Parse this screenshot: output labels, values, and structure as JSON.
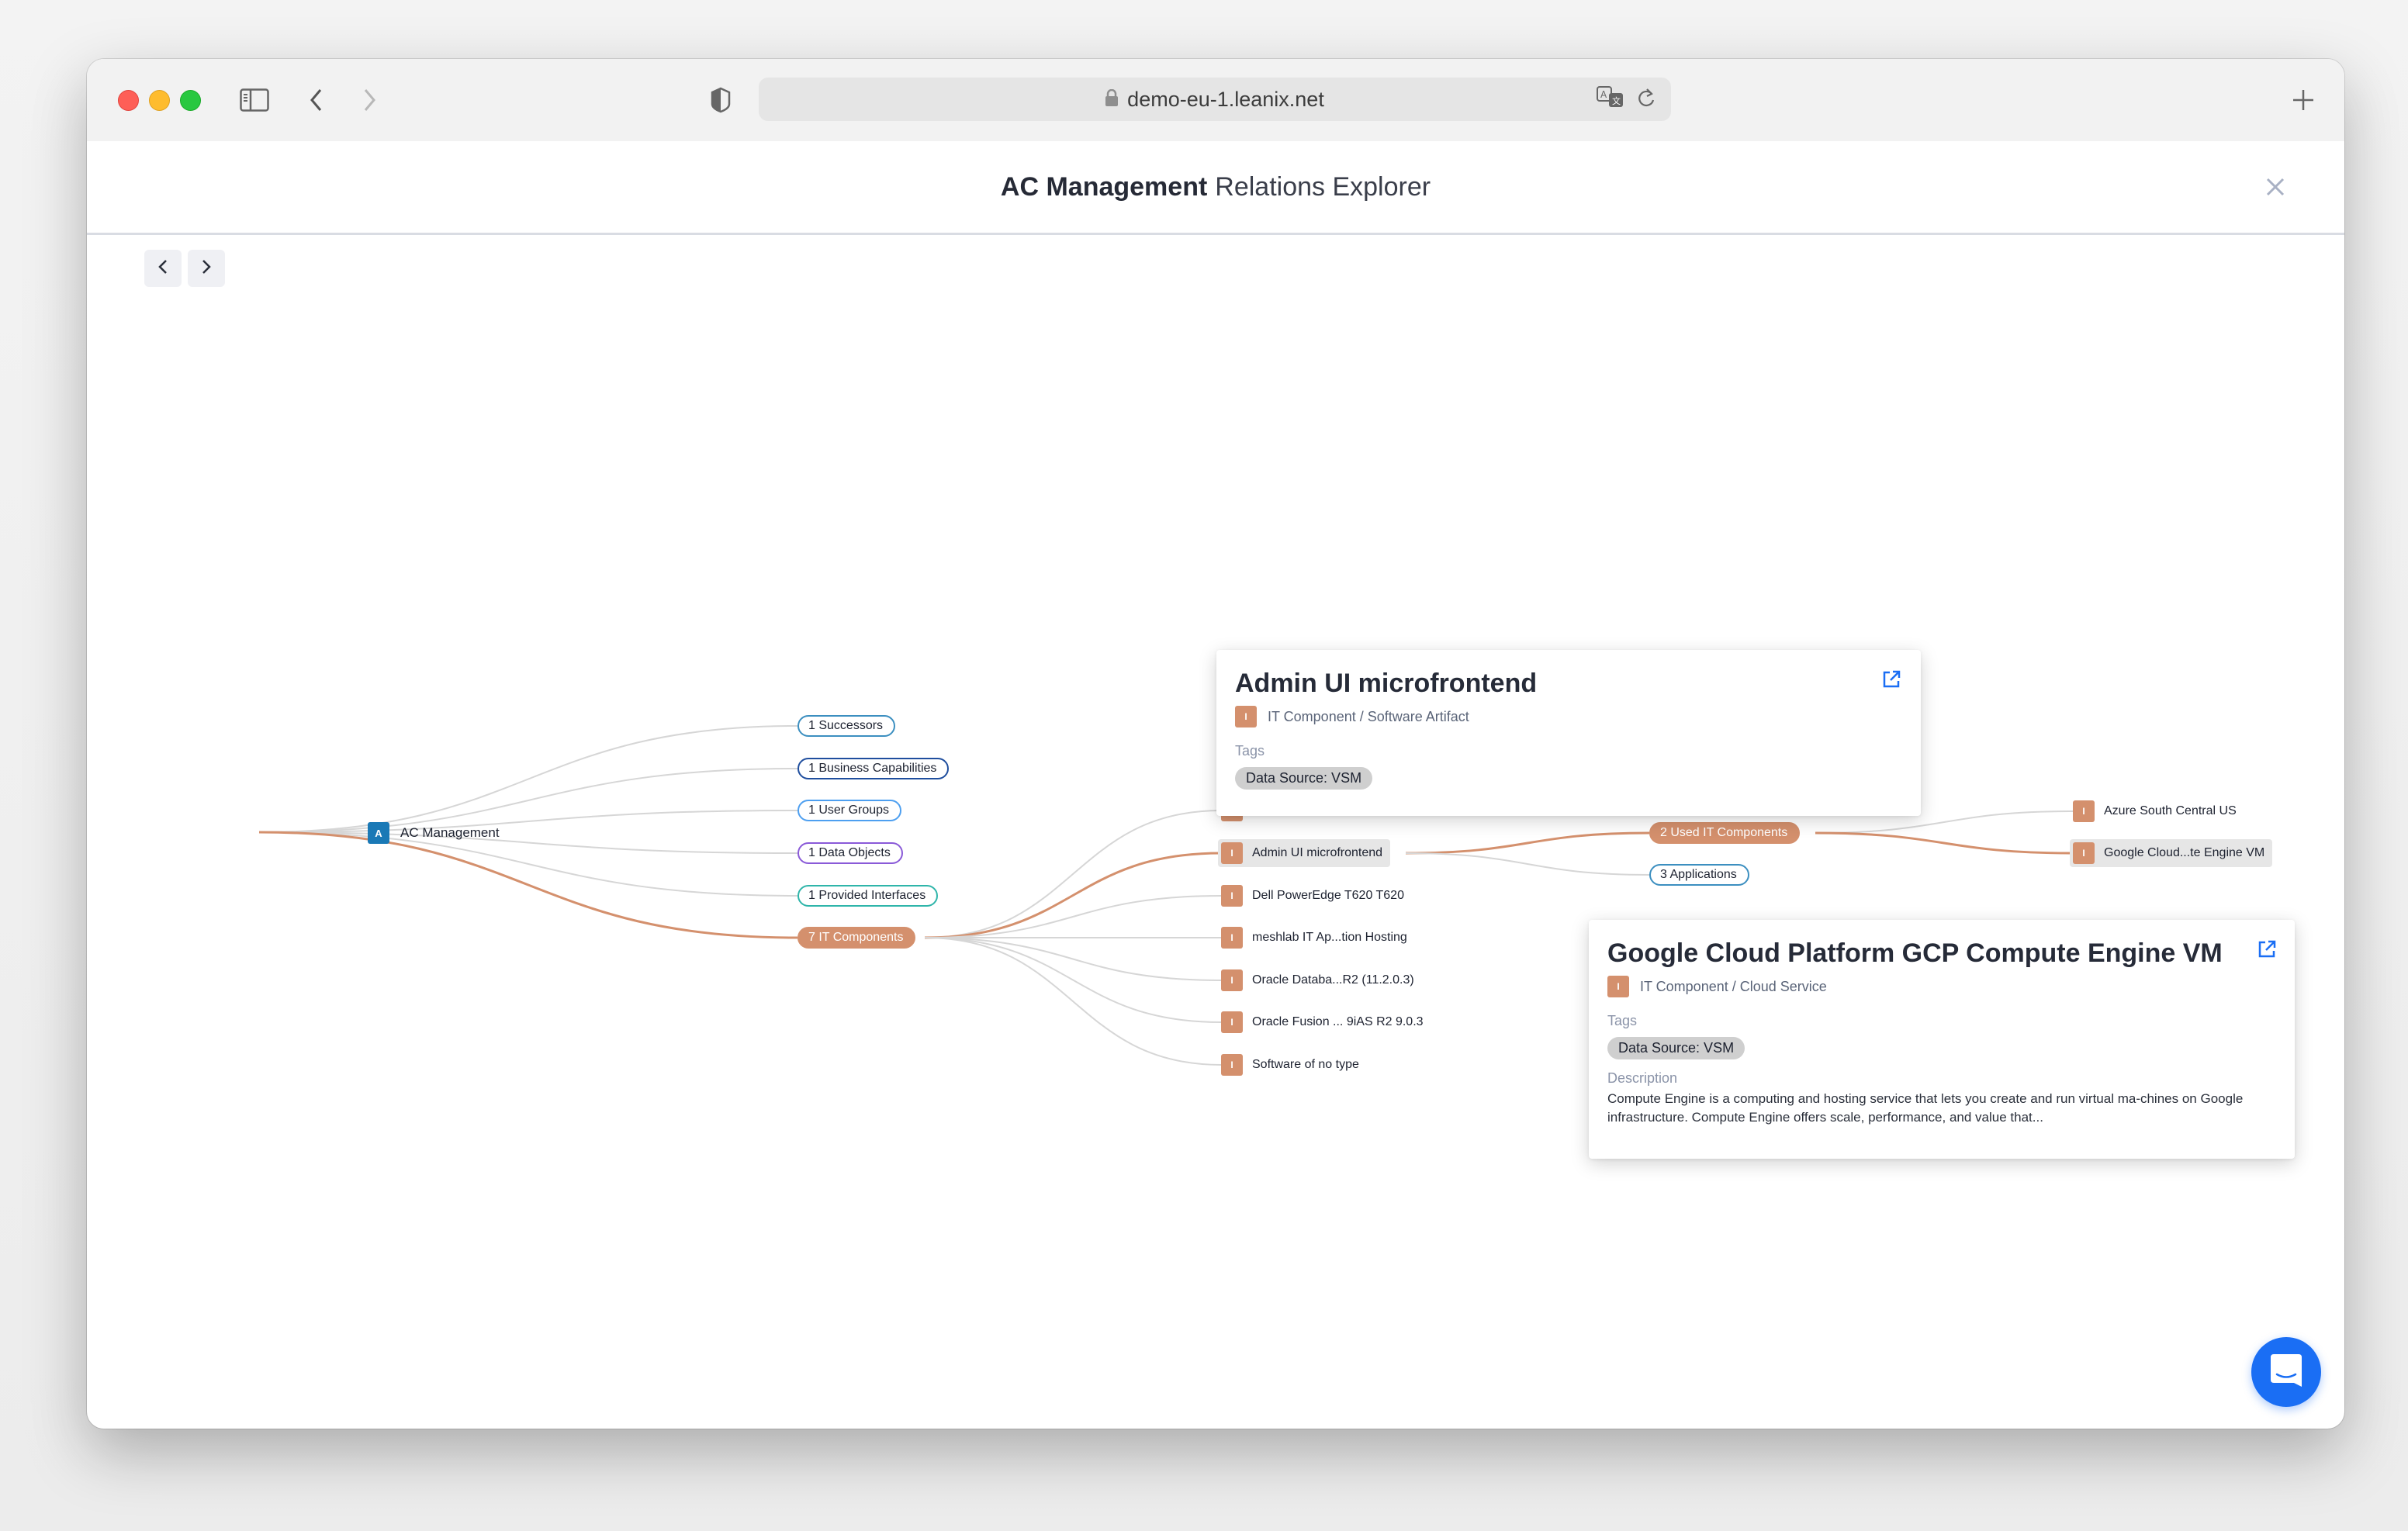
{
  "browser": {
    "url": "demo-eu-1.leanix.net",
    "icons": {
      "sidebar": "sidebar-toggle-icon",
      "back": "chevron-left-icon",
      "forward": "chevron-right-icon",
      "privacy": "shield-icon",
      "lock": "lock-icon",
      "translate": "translate-icon",
      "reload": "reload-icon",
      "new_tab": "plus-icon"
    }
  },
  "header": {
    "title_bold": "AC Management",
    "title_light": "Relations Explorer",
    "close_icon": "close-icon"
  },
  "history_nav": {
    "prev_icon": "chevron-left-icon",
    "next_icon": "chevron-right-icon"
  },
  "graph": {
    "root": {
      "badge": "A",
      "label": "AC Management",
      "color": "#1a79b6"
    },
    "relation_groups": [
      {
        "label": "1 Successors",
        "border": "#3c8fc0",
        "filled": false
      },
      {
        "label": "1 Business Capabilities",
        "border": "#1f4e9e",
        "filled": false
      },
      {
        "label": "1 User Groups",
        "border": "#4d9ff0",
        "filled": false
      },
      {
        "label": "1 Data Objects",
        "border": "#8a5ad8",
        "filled": false
      },
      {
        "label": "1 Provided Interfaces",
        "border": "#2fb5aa",
        "filled": false
      },
      {
        "label": "7 IT Components",
        "border": "#d4906d",
        "filled": true
      }
    ],
    "it_components": [
      {
        "badge": "I",
        "label": "",
        "hidden_by_popover": true,
        "selected": false
      },
      {
        "badge": "I",
        "label": "Admin UI microfrontend",
        "selected": true
      },
      {
        "badge": "I",
        "label": "Dell PowerEdge T620 T620",
        "selected": false
      },
      {
        "badge": "I",
        "label": "meshlab IT Ap...tion Hosting",
        "selected": false
      },
      {
        "badge": "I",
        "label": "Oracle Databa...R2 (11.2.0.3)",
        "selected": false
      },
      {
        "badge": "I",
        "label": "Oracle Fusion ... 9iAS R2 9.0.3",
        "selected": false
      },
      {
        "badge": "I",
        "label": "Software of no type",
        "selected": false
      }
    ],
    "second_level_groups": [
      {
        "label": "2 Used IT Components",
        "border": "#d4906d",
        "filled": true
      },
      {
        "label": "3 Applications",
        "border": "#3c8fc0",
        "filled": false
      }
    ],
    "used_it_components": [
      {
        "badge": "I",
        "label": "Azure South Central US",
        "selected": false
      },
      {
        "badge": "I",
        "label": "Google Cloud...te Engine VM",
        "selected": true
      }
    ],
    "colors": {
      "active_edge": "#d4906d",
      "inactive_edge": "#d6d6d6",
      "it_component": "#d4906d"
    }
  },
  "popovers": [
    {
      "title": "Admin UI microfrontend",
      "badge": "I",
      "type": "IT Component / Software Artifact",
      "tags_label": "Tags",
      "tags": [
        "Data Source: VSM"
      ],
      "link_icon": "external-link-icon"
    },
    {
      "title": "Google Cloud Platform GCP Compute Engine VM",
      "badge": "I",
      "type": "IT Component / Cloud Service",
      "tags_label": "Tags",
      "tags": [
        "Data Source: VSM"
      ],
      "description_label": "Description",
      "description": "Compute Engine is a computing and hosting service that lets you create and run virtual ma-chines on Google infrastructure. Compute Engine offers scale, performance, and value that...",
      "link_icon": "external-link-icon"
    }
  ],
  "chat": {
    "icon": "chat-icon",
    "color": "#1a6ef4"
  }
}
